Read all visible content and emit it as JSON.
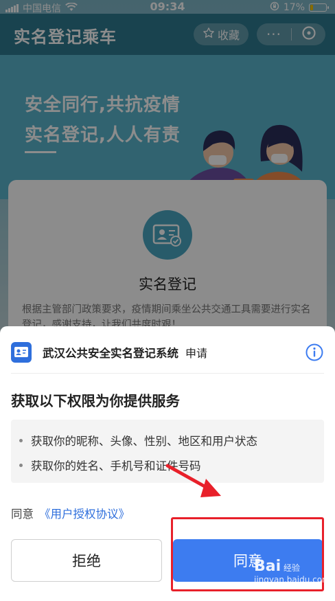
{
  "status_bar": {
    "carrier": "中国电信",
    "time": "09:34",
    "battery_percent": "17%",
    "battery_level": 0.17,
    "signal_icon": "signal-icon",
    "wifi_icon": "wifi-icon",
    "lock_icon": "orientation-lock-icon"
  },
  "nav": {
    "title": "实名登记乘车",
    "favorite_label": "收藏",
    "more_label": "···",
    "star_icon": "star-icon",
    "close_icon": "close-circle-icon"
  },
  "hero": {
    "line1": "安全同行,共抗疫情",
    "line2": "实名登记,人人有责"
  },
  "card": {
    "title": "实名登记",
    "description": "根据主管部门政策要求，疫情期间乘坐公共交通工具需要进行实名登记，感谢支持，让我们共度时艰！"
  },
  "sheet": {
    "app_name": "武汉公共安全实名登记系统",
    "apply_label": "申请",
    "permissions_title": "获取以下权限为你提供服务",
    "permissions": [
      "获取你的昵称、头像、性别、地区和用户状态",
      "获取你的姓名、手机号和证件号码"
    ],
    "agree_prefix": "同意",
    "agreement_link": "《用户授权协议》",
    "reject_label": "拒绝",
    "agree_label": "同意"
  },
  "watermark": {
    "logo": "Bai",
    "sub": "jingyan.baidu.com",
    "tag": "经验"
  },
  "colors": {
    "primary_blue": "#3d7cf0",
    "nav_teal": "#2e7a90",
    "annotation_red": "#e8202a"
  }
}
